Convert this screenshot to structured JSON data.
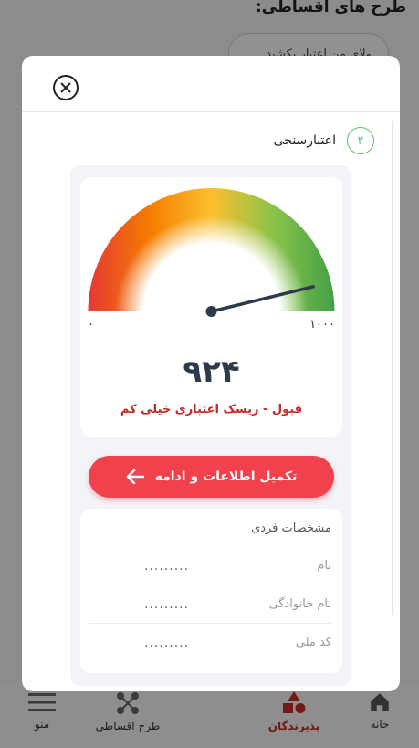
{
  "background": {
    "title": "طرح های اقساطی:",
    "pill_text": "ولای من اعتبار بکشید"
  },
  "bottom_nav": {
    "items": [
      {
        "label": "خانه",
        "icon": "home-icon",
        "active": false
      },
      {
        "label": "پذیرندگان",
        "icon": "shapes-icon",
        "active": true
      },
      {
        "label": "طرح اقساطی",
        "icon": "nodes-icon",
        "active": false
      },
      {
        "label": "منو",
        "icon": "hamburger-icon",
        "active": false
      }
    ]
  },
  "modal": {
    "close_icon": "close-icon",
    "step": {
      "number": "۲",
      "label": "اعتبارسنجی"
    },
    "gauge": {
      "min_label": "۰",
      "max_label": "۱۰۰۰",
      "min": 0,
      "max": 1000,
      "value": 924,
      "score_display": "۹۲۴",
      "status": "قبول - ریسک اعتباری خیلی کم",
      "colors": [
        "#e53935",
        "#f57c00",
        "#fbc02d",
        "#8bc34a",
        "#43a047"
      ]
    },
    "cta": {
      "label": "تکمیل اطلاعات و ادامه",
      "icon": "arrow-left-icon"
    },
    "personal_info": {
      "title": "مشخصات فردی",
      "rows": [
        {
          "label": "نام",
          "value": "........."
        },
        {
          "label": "نام خانوادگی",
          "value": "........."
        },
        {
          "label": "کد ملی",
          "value": "........."
        }
      ]
    }
  },
  "colors": {
    "accent": "#f0414d",
    "status_red": "#c62828",
    "step_green": "#5bbf6a"
  }
}
